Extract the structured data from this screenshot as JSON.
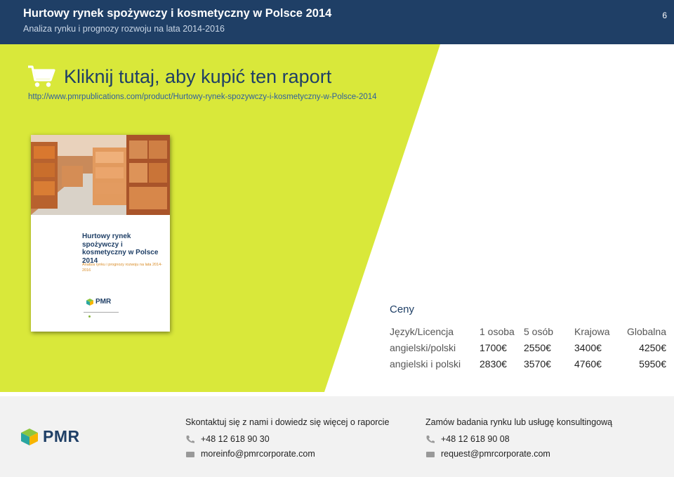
{
  "header": {
    "title": "Hurtowy rynek spożywczy i kosmetyczny w Polsce 2014",
    "subtitle": "Analiza rynku i prognozy rozwoju na lata 2014-2016",
    "page_number": "6"
  },
  "promo": {
    "buy_label": "Kliknij tutaj, aby kupić ten raport",
    "url": "http://www.pmrpublications.com/product/Hurtowy-rynek-spozywczy-i-kosmetyczny-w-Polsce-2014"
  },
  "cover": {
    "title": "Hurtowy rynek spożywczy i kosmetyczny w Polsce 2014",
    "subtitle": "Analiza rynku i prognozy rozwoju na lata 2014-2016",
    "logo_text": "PMR"
  },
  "prices": {
    "title": "Ceny",
    "headers": [
      "Język/Licencja",
      "1 osoba",
      "5 osób",
      "Krajowa",
      "Globalna"
    ],
    "rows": [
      [
        "angielski/polski",
        "1700€",
        "2550€",
        "3400€",
        "4250€"
      ],
      [
        "angielski i polski",
        "2830€",
        "3570€",
        "4760€",
        "5950€"
      ]
    ]
  },
  "footer": {
    "logo_text": "PMR",
    "contact_left": {
      "heading": "Skontaktuj się z nami i dowiedz się więcej  o raporcie",
      "phone": "+48 12 618 90 30",
      "email": "moreinfo@pmrcorporate.com"
    },
    "contact_right": {
      "heading": "Zamów badania rynku lub  usługę konsultingową",
      "phone": "+48 12 618 90 08",
      "email": "request@pmrcorporate.com"
    }
  },
  "colors": {
    "header_bg": "#1f3f66",
    "accent_green": "#d9e83a",
    "brand_blue": "#1f3f66"
  }
}
